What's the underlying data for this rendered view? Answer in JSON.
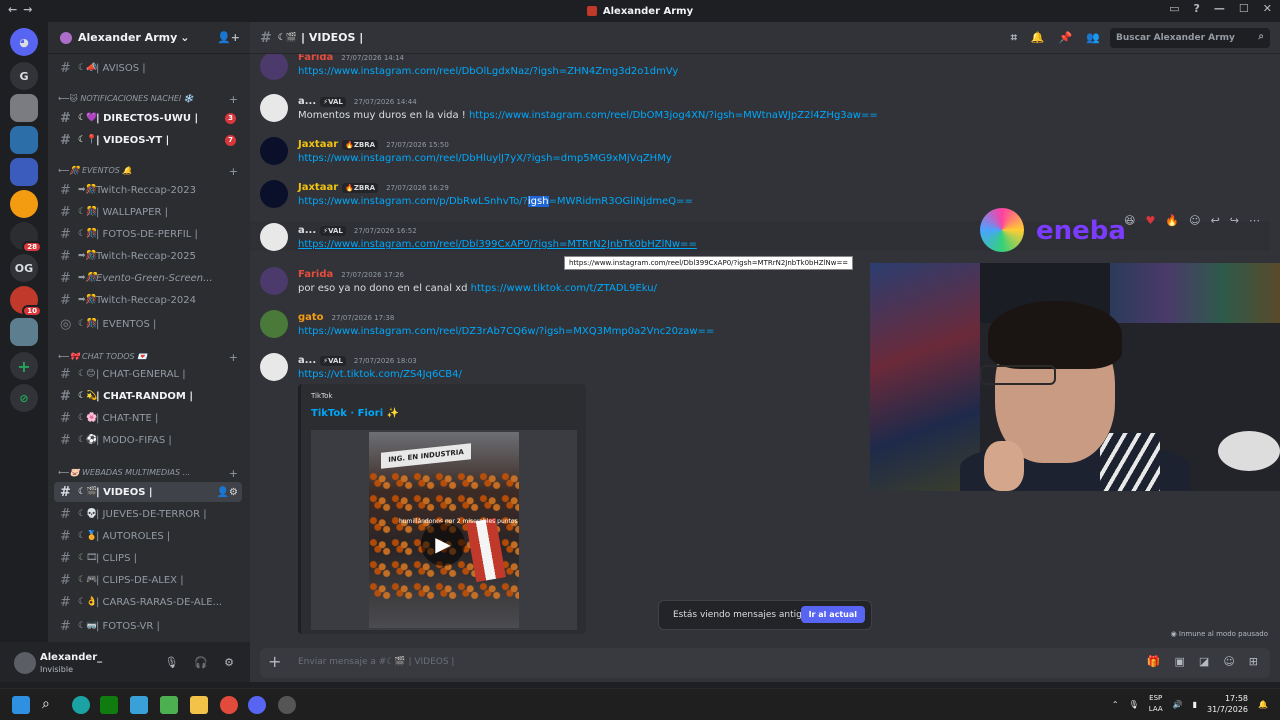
{
  "window": {
    "title": "Alexander Army"
  },
  "servers": [
    {
      "label": "G"
    },
    {
      "label": ""
    },
    {
      "label": ""
    },
    {
      "label": ""
    },
    {
      "label": ""
    },
    {
      "label": "",
      "badge": "28"
    },
    {
      "label": "OG"
    },
    {
      "label": "",
      "badge": "10"
    },
    {
      "label": ""
    }
  ],
  "guild": {
    "name": "Alexander Army"
  },
  "channels": {
    "avisos": "| AVISOS |",
    "cat_notif": "NOTIFICACIONES NACHEI ❄️",
    "directos": "| DIRECTOS-UWU |",
    "directos_badge": "3",
    "videos_yt": "| VIDEOS-YT |",
    "videos_yt_badge": "7",
    "cat_eventos": "EVENTOS 🔔",
    "twitch2023": "Twitch-Reccap-2023",
    "wallpaper": "| WALLPAPER |",
    "fotos_perfil": "| FOTOS-DE-PERFIL |",
    "twitch2025": "Twitch-Reccap-2025",
    "evento_green": "Evento-Green-Screen...",
    "twitch2024": "Twitch-Reccap-2024",
    "eventos": "| EVENTOS |",
    "cat_chat": "CHAT TODOS 💌",
    "chat_general": "| CHAT-GENERAL |",
    "chat_random": "| CHAT-RANDOM |",
    "chat_nte": "| CHAT-NTE |",
    "modo_fifas": "| MODO-FIFAS |",
    "cat_webadas": "WEBADAS MULTIMEDIAS ...",
    "videos": "| VIDEOS |",
    "jueves": "| JUEVES-DE-TERROR |",
    "autoroles": "| AUTOROLES |",
    "clips": "| CLIPS |",
    "clips_alex": "| CLIPS-DE-ALEX |",
    "caras": "| CARAS-RARAS-DE-ALE...",
    "fotos_vr": "| FOTOS-VR |"
  },
  "user": {
    "name": "Alexander_",
    "status": "Invisible"
  },
  "header": {
    "channel": "| VIDEOS |",
    "search_placeholder": "Buscar Alexander Army"
  },
  "messages": [
    {
      "author": "Farida",
      "color": "#e74c3c",
      "tag": "",
      "time": "27/07/2026 14:14",
      "text": "",
      "link": "https://www.instagram.com/reel/DbOlLgdxNaz/?igsh=ZHN4Zmg3d2o1dmVy"
    },
    {
      "author": "a...",
      "color": "#dbdee1",
      "tag": "⚡VAL",
      "time": "27/07/2026 14:44",
      "text": "Momentos muy duros en la vida ! ",
      "link": "https://www.instagram.com/reel/DbOM3jog4XN/?igsh=MWtnaWJpZ2l4ZHg3aw=="
    },
    {
      "author": "Jaxtaar",
      "color": "#f1c40f",
      "tag": "🔥ZBRA",
      "time": "27/07/2026 15:50",
      "text": "",
      "link": "https://www.instagram.com/reel/DbHluylJ7yX/?igsh=dmp5MG9xMjVqZHMy"
    },
    {
      "author": "Jaxtaar",
      "color": "#f1c40f",
      "tag": "🔥ZBRA",
      "time": "27/07/2026 16:29",
      "text": "",
      "link_a": "https://www.instagram.com/p/DbRwLSnhvTo/?",
      "link_hl": "igsh",
      "link_b": "=MWRidmR3OGliNjdmeQ=="
    },
    {
      "author": "a...",
      "color": "#dbdee1",
      "tag": "⚡VAL",
      "time": "27/07/2026 16:52",
      "text": "",
      "link": "https://www.instagram.com/reel/Dbl399CxAP0/?igsh=MTRrN2JnbTk0bHZlNw=="
    },
    {
      "author": "Farida",
      "color": "#e74c3c",
      "tag": "",
      "time": "27/07/2026 17:26",
      "text": "por eso ya no dono en el canal xd ",
      "link": "https://www.tiktok.com/t/ZTADL9Eku/"
    },
    {
      "author": "gato",
      "color": "#f39c12",
      "tag": "",
      "time": "27/07/2026 17:38",
      "text": "",
      "link": "https://www.instagram.com/reel/DZ3rAb7CQ6w/?igsh=MXQ3Mmp0a2Vnc20zaw=="
    },
    {
      "author": "a...",
      "color": "#dbdee1",
      "tag": "⚡VAL",
      "time": "27/07/2026 18:03",
      "text": "",
      "link": "https://vt.tiktok.com/ZS4Jq6CB4/"
    }
  ],
  "tooltip": "https://www.instagram.com/reel/Dbl399CxAP0/?igsh=MTRrN2JnbTk0bHZlNw==",
  "embed": {
    "provider": "TikTok",
    "title": "TikTok · Fiori ✨",
    "banner": "ING. EN INDUSTRIA",
    "caption": "humillándonos por 2 miserables puntos"
  },
  "old_messages": {
    "text": "Estás viendo mensajes antiguos",
    "button": "Ir al actual"
  },
  "immune": "Inmune al modo pausado",
  "composer": {
    "placeholder": "Enviar mensaje a #☾🎬 | VIDEOS |"
  },
  "overlay": {
    "brand": "eneba"
  },
  "taskbar": {
    "lang1": "ESP",
    "lang2": "LAA",
    "time": "17:58",
    "date": "31/7/2026"
  }
}
